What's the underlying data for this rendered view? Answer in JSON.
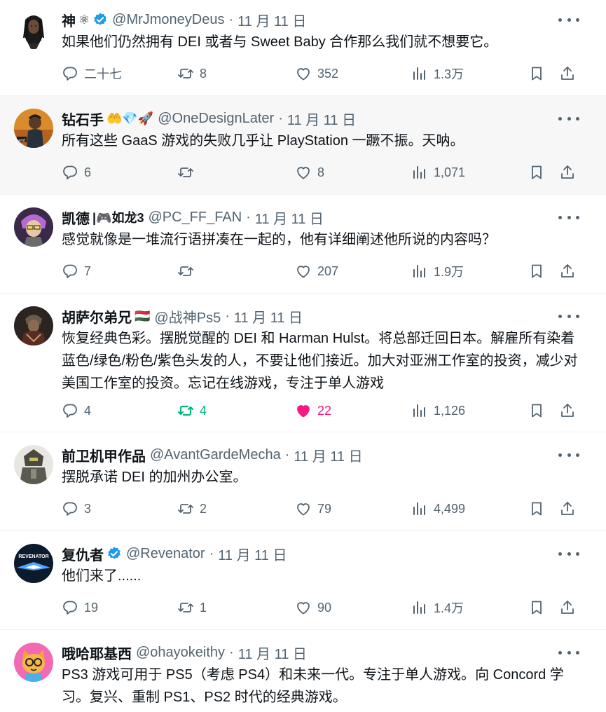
{
  "colors": {
    "text": "#0f1419",
    "muted": "#536471",
    "verified": "#1d9bf0",
    "retweet_active": "#00ba7c",
    "like_active": "#f91880"
  },
  "tweets": [
    {
      "name": "神",
      "name_extra": "⚛",
      "verified": true,
      "handle": "@MrJmoneyDeus",
      "sep": "·",
      "time": "11 月 11 日",
      "text": "如果他们仍然拥有 DEI 或者与 Sweet Baby 合作那么我们就不想要它。",
      "replies": "二十七",
      "retweets": "8",
      "likes": "352",
      "views": "1.3万",
      "retweeted": false,
      "liked": false,
      "avatar_icon": "dreadlocks-character-avatar"
    },
    {
      "name": "钻石手",
      "name_extra": "🤲💎🚀",
      "verified": false,
      "handle": "@OneDesignLater",
      "sep": "·",
      "time": "11 月 11 日",
      "text": "所有这些 GaaS 游戏的失败几乎让 PlayStation 一蹶不振。天呐。",
      "replies": "6",
      "retweets": "",
      "likes": "8",
      "views": "1,071",
      "retweeted": false,
      "liked": false,
      "avatar_icon": "gta-character-avatar"
    },
    {
      "name": "凯德",
      "name_extra": "|🎮如龙3",
      "verified": false,
      "handle": "@PC_FF_FAN",
      "sep": "·",
      "time": "11 月 11 日",
      "text": "感觉就像是一堆流行语拼凑在一起的，他有详细阐述他所说的内容吗？",
      "replies": "7",
      "retweets": "",
      "likes": "207",
      "views": "1.9万",
      "retweeted": false,
      "liked": false,
      "avatar_icon": "anime-character-avatar"
    },
    {
      "name": "胡萨尔弟兄",
      "name_extra": "🇭🇺",
      "verified": false,
      "handle": "@战神Ps5",
      "sep": "·",
      "time": "11 月 11 日",
      "text": "恢复经典色彩。摆脱觉醒的 DEI 和 Harman Hulst。将总部迁回日本。解雇所有染着蓝色/绿色/粉色/紫色头发的人，不要让他们接近。加大对亚洲工作室的投资，减少对美国工作室的投资。忘记在线游戏，专注于单人游戏",
      "replies": "4",
      "retweets": "4",
      "likes": "22",
      "views": "1,126",
      "retweeted": true,
      "liked": true,
      "avatar_icon": "hussar-warrior-avatar"
    },
    {
      "name": "前卫机甲作品",
      "name_extra": "",
      "verified": false,
      "handle": "@AvantGardeMecha",
      "sep": "·",
      "time": "11 月 11 日",
      "text": "摆脱承诺 DEI 的加州办公室。",
      "replies": "3",
      "retweets": "2",
      "likes": "79",
      "views": "4,499",
      "retweeted": false,
      "liked": false,
      "avatar_icon": "mecha-robot-avatar"
    },
    {
      "name": "复仇者",
      "name_extra": "",
      "verified": true,
      "handle": "@Revenator",
      "sep": "·",
      "time": "11 月 11 日",
      "text": "他们来了......",
      "replies": "19",
      "retweets": "1",
      "likes": "90",
      "views": "1.4万",
      "retweeted": false,
      "liked": false,
      "avatar_icon": "revenator-logo-avatar",
      "avatar_text": "REVENATOR"
    },
    {
      "name": "哦哈耶基西",
      "name_extra": "",
      "verified": false,
      "handle": "@ohayokeithy",
      "sep": "·",
      "time": "11 月 11 日",
      "text": "PS3 游戏可用于 PS5（考虑 PS4）和未来一代。专注于单人游戏。向 Concord 学习。复兴、重制 PS1、PS2 时代的经典游戏。",
      "avatar_icon": "cartoon-cat-avatar"
    }
  ]
}
